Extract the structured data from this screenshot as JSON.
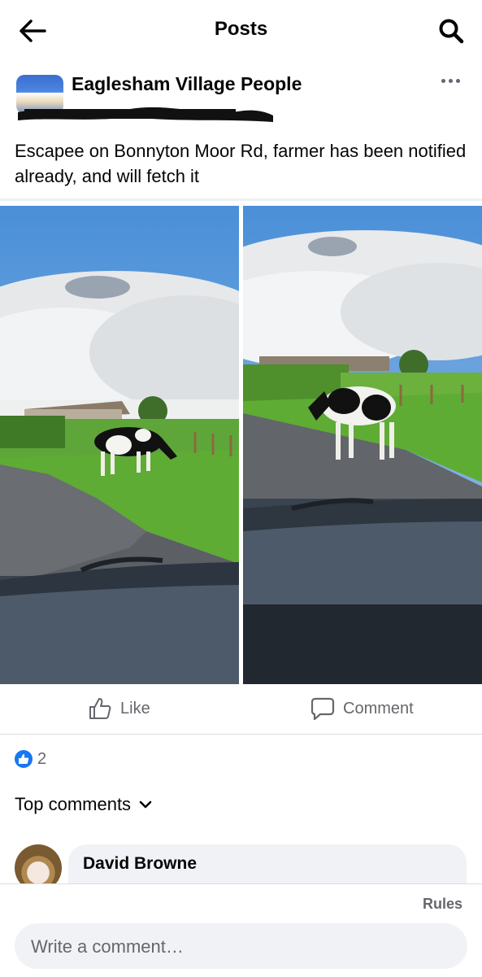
{
  "header": {
    "title": "Posts"
  },
  "post": {
    "group_name": "Eaglesham Village People",
    "text": "Escapee on Bonnyton Moor Rd, farmer has been notified already, and will fetch it",
    "like_label": "Like",
    "comment_label": "Comment",
    "reaction_count": "2"
  },
  "comments": {
    "section_label": "Top comments",
    "items": [
      {
        "author": "David Browne"
      }
    ]
  },
  "footer": {
    "rules_label": "Rules",
    "placeholder": "Write a comment…"
  },
  "colors": {
    "accent": "#1877f2",
    "muted_text": "#65676b",
    "bubble_bg": "#f0f2f5"
  },
  "icons": [
    "back-arrow-icon",
    "search-icon",
    "more-icon",
    "like-icon",
    "comment-icon",
    "chevron-down-icon",
    "like-reaction-icon"
  ]
}
